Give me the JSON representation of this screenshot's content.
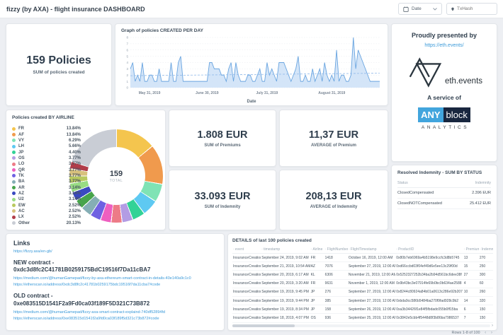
{
  "header": {
    "title": "fizzy (by AXA) - flight insurance DASHBOARD",
    "date_label": "Date",
    "txhash_placeholder": "TxHash"
  },
  "policies_card": {
    "value": "159 Policies",
    "subtitle": "SUM of policies created"
  },
  "chart_data": [
    {
      "type": "area",
      "title": "Graph of policies CREATED PER DAY",
      "xlabel": "Date",
      "ylabel": "",
      "ylim": [
        0,
        8
      ],
      "yticks": [
        0,
        1,
        2,
        3,
        4,
        5,
        6,
        7,
        8
      ],
      "grid": "dashed",
      "x_ticks": [
        {
          "label": "May 31, 2019",
          "index": 8
        },
        {
          "label": "June 30, 2019",
          "index": 32
        },
        {
          "label": "July 31, 2019",
          "index": 57
        },
        {
          "label": "August 31, 2019",
          "index": 84
        }
      ],
      "values": [
        3,
        4,
        1,
        2,
        1,
        4,
        1,
        1,
        2,
        2,
        1,
        1,
        3,
        1,
        1,
        1,
        1,
        4,
        1,
        1,
        4,
        5,
        1,
        1,
        1,
        1,
        1,
        1,
        1,
        1,
        1,
        1,
        1,
        4,
        4,
        3,
        3,
        3,
        2,
        2,
        1,
        3,
        4,
        1,
        4,
        2,
        1,
        1,
        1,
        2,
        2,
        1,
        1,
        2,
        3,
        1,
        1,
        4,
        2,
        3,
        2,
        1,
        4,
        4,
        4,
        3,
        2,
        1,
        2,
        3,
        5,
        1,
        1,
        2,
        1,
        1,
        3,
        1,
        2,
        3,
        1,
        4,
        2,
        1,
        2,
        1,
        6,
        1,
        2,
        2,
        1,
        1,
        2,
        8,
        3,
        6,
        5,
        4,
        3,
        2,
        1,
        1,
        1,
        1,
        1
      ],
      "avg_line": {
        "start": 1.9,
        "end": 2.3
      },
      "colors": {
        "line": "#6aa5e0",
        "fill": "#cfe2f7",
        "avg": "#8fb9ea"
      }
    },
    {
      "type": "donut",
      "title": "Policies created BY AIRLINE",
      "center_value": "159",
      "center_label": "TOTAL",
      "slices": [
        {
          "label": "FR",
          "pct": 13.84,
          "color": "#f4c54e"
        },
        {
          "label": "AF",
          "pct": 13.84,
          "color": "#f09a4d"
        },
        {
          "label": "VY",
          "pct": 6.29,
          "color": "#7fe3b5"
        },
        {
          "label": "LH",
          "pct": 5.66,
          "color": "#5ec9f2"
        },
        {
          "label": "JP",
          "pct": 4.4,
          "color": "#32d296"
        },
        {
          "label": "OS",
          "pct": 3.77,
          "color": "#b39ce4"
        },
        {
          "label": "LO",
          "pct": 3.77,
          "color": "#ed7b87"
        },
        {
          "label": "QR",
          "pct": 3.77,
          "color": "#ee5fc0"
        },
        {
          "label": "TK",
          "pct": 3.77,
          "color": "#6f61e2"
        },
        {
          "label": "BA",
          "pct": 3.77,
          "color": "#85aeb5"
        },
        {
          "label": "AR",
          "pct": 3.14,
          "color": "#47a44b"
        },
        {
          "label": "AZ",
          "pct": 3.14,
          "color": "#3a49c0"
        },
        {
          "label": "U2",
          "pct": 3.14,
          "color": "#98dc83"
        },
        {
          "label": "EW",
          "pct": 2.52,
          "color": "#b8c95f"
        },
        {
          "label": "AC",
          "pct": 2.52,
          "color": "#d8c17d"
        },
        {
          "label": "LX",
          "pct": 2.52,
          "color": "#b13c49"
        },
        {
          "label": "Other",
          "pct": 20.13,
          "color": "#c9cdd5"
        }
      ]
    }
  ],
  "presented_by": {
    "title": "Proudly presented by",
    "link": "https://eth.events/",
    "logo_text": "eth.events",
    "service_label": "A service of",
    "brand_any": "ANY",
    "brand_block": "block",
    "brand_analytics": "ANALYTICS"
  },
  "kpis": [
    {
      "value": "1.808 EUR",
      "label": "SUM of Premiums"
    },
    {
      "value": "11,37 EUR",
      "label": "AVERAGE of Premium"
    },
    {
      "value": "33.093 EUR",
      "label": "SUM of Indemnity"
    },
    {
      "value": "208,13 EUR",
      "label": "AVERAGE of Indemnity"
    }
  ],
  "resolved_indemnity": {
    "title": "Resolved Indemnity - SUM BY STATUS",
    "columns": [
      "Status",
      "Indemnity"
    ],
    "rows": [
      {
        "status": "ClosedCompensated",
        "indemnity": "2.396 EUR"
      },
      {
        "status": "ClosedNOTCompensated",
        "indemnity": "25.412 EUR"
      }
    ]
  },
  "links": {
    "title": "Links",
    "site": "https://fizzy.axa/en-gb/",
    "new_contract_title": "NEW contract - 0xdc3d8fc2C41781B0259175BdC19516f7Da11cBA7",
    "new_links": [
      "https://medium.com/@humanGamepad/fizzy-by-axa-ethereum-smart-contract-in-details-40e140a9c1c0",
      "https://etherscan.io/address/0xdc3d8fc2c41781b0259175bdc19516f7da11cba7#code"
    ],
    "old_contract_title": "OLD contract - 0xe083515D1541F2a9Fd0ca03f189F5D321C73B872",
    "old_links": [
      "https://medium.com/@humanGamepad/fizzy-axa-smart-contract-explaind-740df52894fd",
      "https://etherscan.io/address/0xe083515d1541f2a9fd0ca03f189f5d321c73b872#code"
    ]
  },
  "details_table": {
    "title": "DETAILS of last 100 policies created",
    "columns": [
      "event",
      "timestamp",
      "Airline",
      "FlightNumber",
      "FlightTimestamp",
      "ProductID",
      "Premium",
      "Indemnity"
    ],
    "rows": [
      [
        "InsuranceCreation",
        "September 24, 2019, 9:02 AM",
        "FR",
        "1418",
        "October 16, 2019, 12:00 AM",
        "0x80b7eb6969a4b5198e9ccfc3d8b5745",
        "13",
        "270"
      ],
      [
        "InsuranceCreation",
        "September 21, 2019, 10:54 AM",
        "AZ",
        "7076",
        "September 27, 2019, 12:00 AM",
        "0xd66ccbd03f04ef49d6e5ee13c29f00d",
        "15",
        "250"
      ],
      [
        "InsuranceCreation",
        "September 20, 2019, 6:17 AM",
        "KL",
        "6306",
        "November 21, 2019, 12:00 AM",
        "0x5252327252b34ba2b94d561bc6dee38f",
        "27",
        "300"
      ],
      [
        "InsuranceCreation",
        "September 20, 2019, 3:20 AM",
        "FR",
        "9631",
        "November 1, 2019, 12:00 AM",
        "0x9b43bc3e07914fe69b0bc0b634ae2588",
        "4",
        "60"
      ],
      [
        "InsuranceCreation",
        "September 19, 2019, 9:45 PM",
        "JP",
        "276",
        "September 27, 2019, 12:00 AM",
        "0x8244c80924a84b01a0613c286e92b207",
        "10",
        "260"
      ],
      [
        "InsuranceCreation",
        "September 19, 2019, 9:44 PM",
        "JP",
        "385",
        "September 27, 2019, 12:00 AM",
        "0xbda9cc586b5484ba270f9fad928c9b2",
        "14",
        "320"
      ],
      [
        "InsuranceCreation",
        "September 19, 2019, 8:34 PM",
        "JP",
        "158",
        "September 26, 2019, 12:00 AM",
        "0xa3b34426f1e84f5fbdadc055b0ff15ba",
        "6",
        "150"
      ],
      [
        "InsuranceCreation",
        "September 18, 2019, 4:07 PM",
        "OS",
        "936",
        "September 25, 2019, 12:00 AM",
        "0x3842e5cbb4f5448d8f3b86ba7986537",
        "7",
        "150"
      ]
    ],
    "footer": "Rows 1-8 of 100",
    "prev_icon": "‹",
    "next_icon": "›"
  }
}
